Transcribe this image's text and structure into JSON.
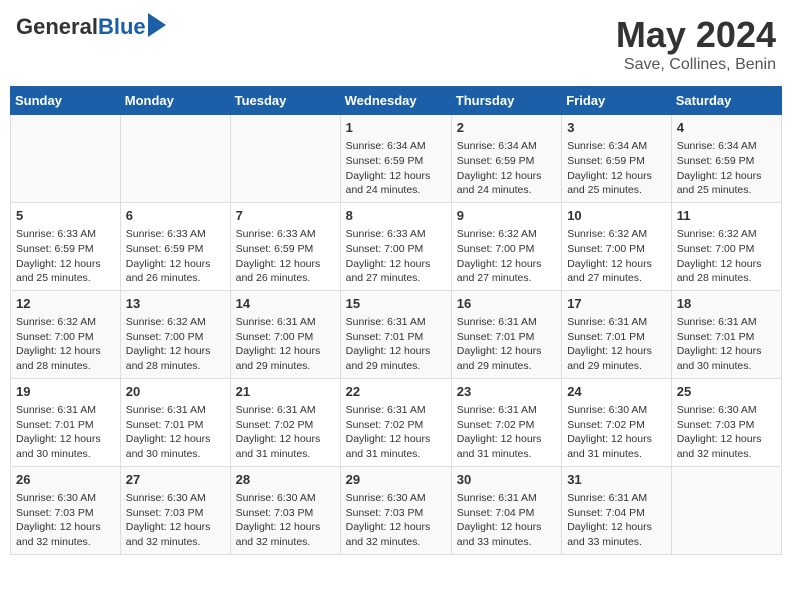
{
  "header": {
    "logo_general": "General",
    "logo_blue": "Blue",
    "month": "May 2024",
    "location": "Save, Collines, Benin"
  },
  "days_of_week": [
    "Sunday",
    "Monday",
    "Tuesday",
    "Wednesday",
    "Thursday",
    "Friday",
    "Saturday"
  ],
  "weeks": [
    [
      {
        "day": "",
        "content": ""
      },
      {
        "day": "",
        "content": ""
      },
      {
        "day": "",
        "content": ""
      },
      {
        "day": "1",
        "content": "Sunrise: 6:34 AM\nSunset: 6:59 PM\nDaylight: 12 hours and 24 minutes."
      },
      {
        "day": "2",
        "content": "Sunrise: 6:34 AM\nSunset: 6:59 PM\nDaylight: 12 hours and 24 minutes."
      },
      {
        "day": "3",
        "content": "Sunrise: 6:34 AM\nSunset: 6:59 PM\nDaylight: 12 hours and 25 minutes."
      },
      {
        "day": "4",
        "content": "Sunrise: 6:34 AM\nSunset: 6:59 PM\nDaylight: 12 hours and 25 minutes."
      }
    ],
    [
      {
        "day": "5",
        "content": "Sunrise: 6:33 AM\nSunset: 6:59 PM\nDaylight: 12 hours and 25 minutes."
      },
      {
        "day": "6",
        "content": "Sunrise: 6:33 AM\nSunset: 6:59 PM\nDaylight: 12 hours and 26 minutes."
      },
      {
        "day": "7",
        "content": "Sunrise: 6:33 AM\nSunset: 6:59 PM\nDaylight: 12 hours and 26 minutes."
      },
      {
        "day": "8",
        "content": "Sunrise: 6:33 AM\nSunset: 7:00 PM\nDaylight: 12 hours and 27 minutes."
      },
      {
        "day": "9",
        "content": "Sunrise: 6:32 AM\nSunset: 7:00 PM\nDaylight: 12 hours and 27 minutes."
      },
      {
        "day": "10",
        "content": "Sunrise: 6:32 AM\nSunset: 7:00 PM\nDaylight: 12 hours and 27 minutes."
      },
      {
        "day": "11",
        "content": "Sunrise: 6:32 AM\nSunset: 7:00 PM\nDaylight: 12 hours and 28 minutes."
      }
    ],
    [
      {
        "day": "12",
        "content": "Sunrise: 6:32 AM\nSunset: 7:00 PM\nDaylight: 12 hours and 28 minutes."
      },
      {
        "day": "13",
        "content": "Sunrise: 6:32 AM\nSunset: 7:00 PM\nDaylight: 12 hours and 28 minutes."
      },
      {
        "day": "14",
        "content": "Sunrise: 6:31 AM\nSunset: 7:00 PM\nDaylight: 12 hours and 29 minutes."
      },
      {
        "day": "15",
        "content": "Sunrise: 6:31 AM\nSunset: 7:01 PM\nDaylight: 12 hours and 29 minutes."
      },
      {
        "day": "16",
        "content": "Sunrise: 6:31 AM\nSunset: 7:01 PM\nDaylight: 12 hours and 29 minutes."
      },
      {
        "day": "17",
        "content": "Sunrise: 6:31 AM\nSunset: 7:01 PM\nDaylight: 12 hours and 29 minutes."
      },
      {
        "day": "18",
        "content": "Sunrise: 6:31 AM\nSunset: 7:01 PM\nDaylight: 12 hours and 30 minutes."
      }
    ],
    [
      {
        "day": "19",
        "content": "Sunrise: 6:31 AM\nSunset: 7:01 PM\nDaylight: 12 hours and 30 minutes."
      },
      {
        "day": "20",
        "content": "Sunrise: 6:31 AM\nSunset: 7:01 PM\nDaylight: 12 hours and 30 minutes."
      },
      {
        "day": "21",
        "content": "Sunrise: 6:31 AM\nSunset: 7:02 PM\nDaylight: 12 hours and 31 minutes."
      },
      {
        "day": "22",
        "content": "Sunrise: 6:31 AM\nSunset: 7:02 PM\nDaylight: 12 hours and 31 minutes."
      },
      {
        "day": "23",
        "content": "Sunrise: 6:31 AM\nSunset: 7:02 PM\nDaylight: 12 hours and 31 minutes."
      },
      {
        "day": "24",
        "content": "Sunrise: 6:30 AM\nSunset: 7:02 PM\nDaylight: 12 hours and 31 minutes."
      },
      {
        "day": "25",
        "content": "Sunrise: 6:30 AM\nSunset: 7:03 PM\nDaylight: 12 hours and 32 minutes."
      }
    ],
    [
      {
        "day": "26",
        "content": "Sunrise: 6:30 AM\nSunset: 7:03 PM\nDaylight: 12 hours and 32 minutes."
      },
      {
        "day": "27",
        "content": "Sunrise: 6:30 AM\nSunset: 7:03 PM\nDaylight: 12 hours and 32 minutes."
      },
      {
        "day": "28",
        "content": "Sunrise: 6:30 AM\nSunset: 7:03 PM\nDaylight: 12 hours and 32 minutes."
      },
      {
        "day": "29",
        "content": "Sunrise: 6:30 AM\nSunset: 7:03 PM\nDaylight: 12 hours and 32 minutes."
      },
      {
        "day": "30",
        "content": "Sunrise: 6:31 AM\nSunset: 7:04 PM\nDaylight: 12 hours and 33 minutes."
      },
      {
        "day": "31",
        "content": "Sunrise: 6:31 AM\nSunset: 7:04 PM\nDaylight: 12 hours and 33 minutes."
      },
      {
        "day": "",
        "content": ""
      }
    ]
  ]
}
